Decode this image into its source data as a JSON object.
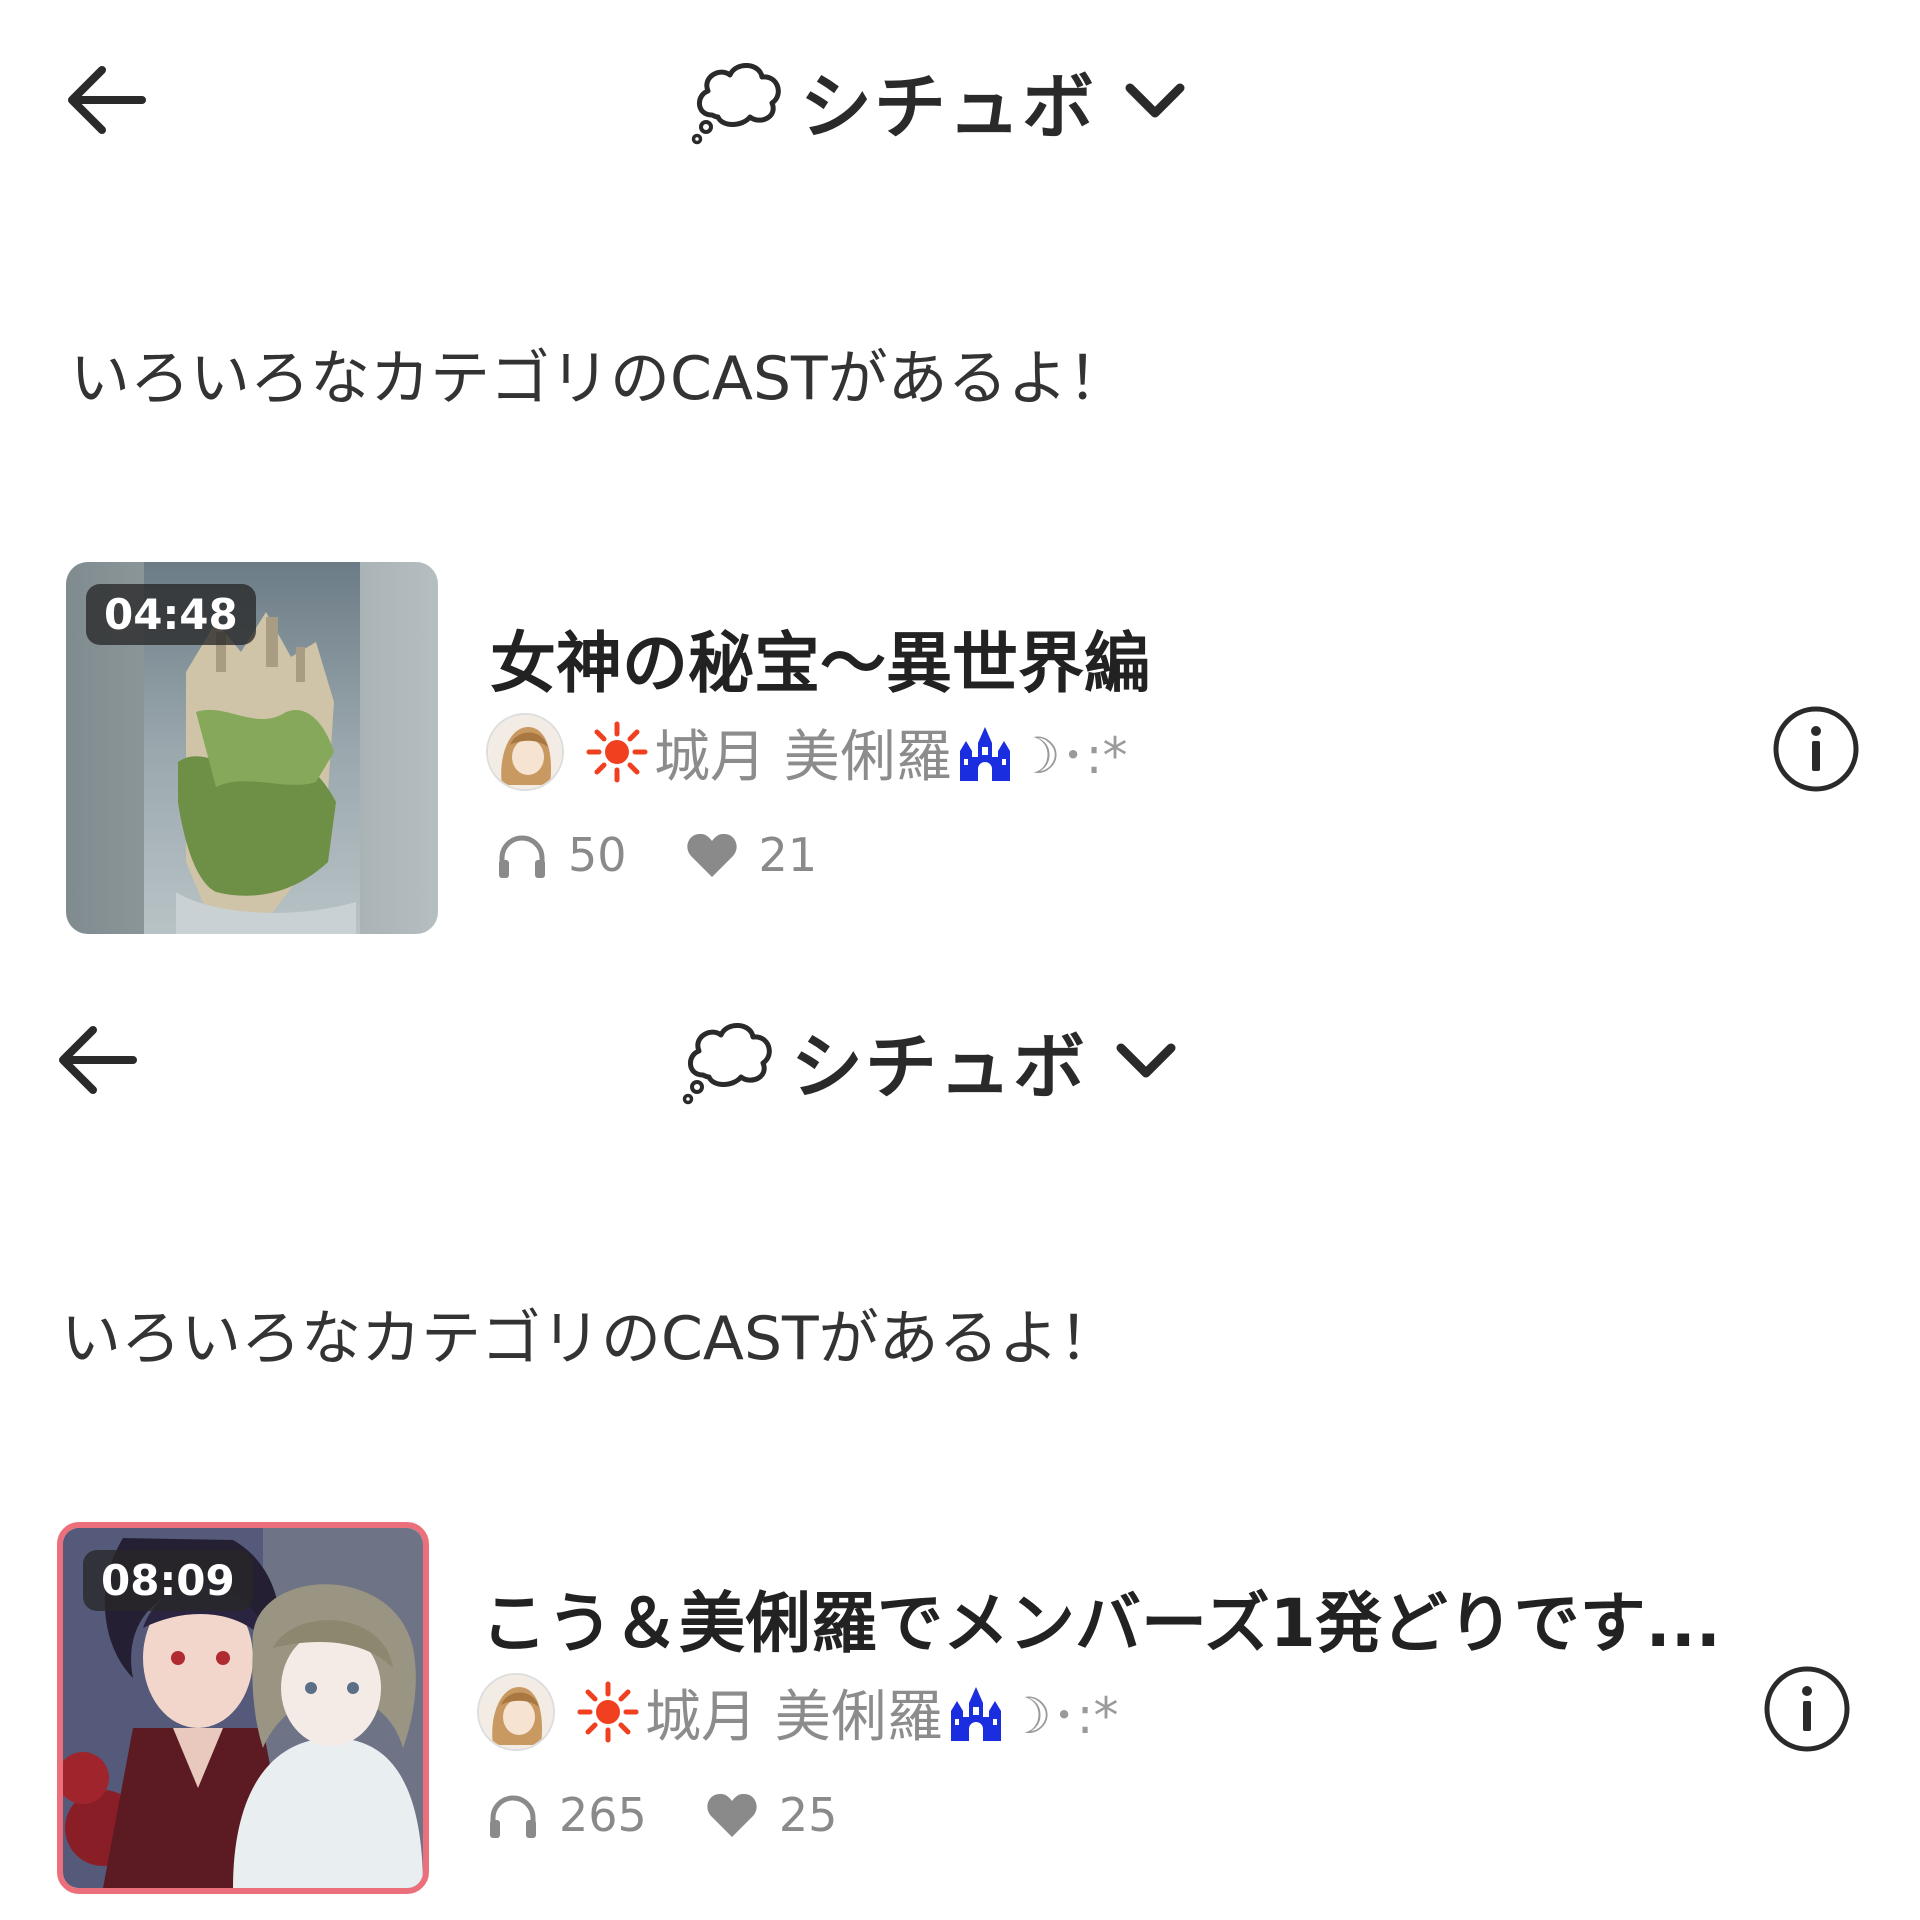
{
  "panels": [
    {
      "header": {
        "title": "シチュボ"
      },
      "description": "いろいろなカテゴリのCASTがあるよ！",
      "cast": {
        "duration": "04:48",
        "title": "女神の秘宝～異世界編",
        "author": "城月 美俐羅",
        "author_suffix": "☽･:*",
        "plays": "50",
        "likes": "21"
      }
    },
    {
      "header": {
        "title": "シチュボ"
      },
      "description": "いろいろなカテゴリのCASTがあるよ！",
      "cast": {
        "duration": "08:09",
        "title": "こう＆美俐羅でメンバーズ1発どりです...",
        "author": "城月 美俐羅",
        "author_suffix": "☽･:*",
        "plays": "265",
        "likes": "25"
      }
    }
  ],
  "colors": {
    "sun": "#f04020",
    "castle": "#1a2ee0",
    "thumb_border_2": "#ec6f7c",
    "muted": "#8c8c8c"
  },
  "icons": [
    "back-arrow-icon",
    "thought-bubble-icon",
    "chevron-down-icon",
    "sun-icon",
    "castle-icon",
    "headphones-icon",
    "heart-icon",
    "info-icon"
  ]
}
